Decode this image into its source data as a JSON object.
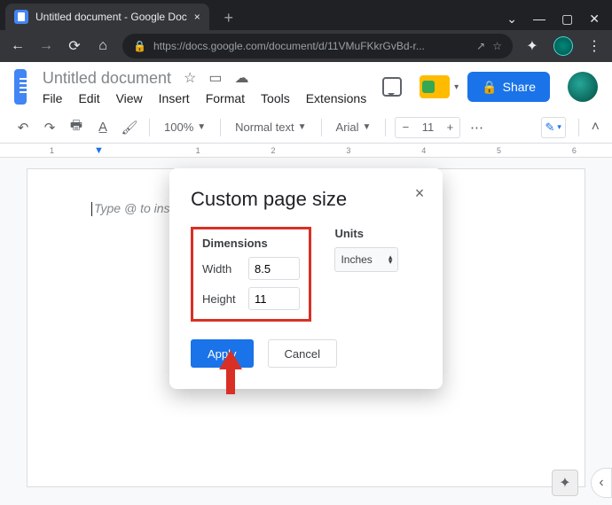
{
  "browser": {
    "tab_title": "Untitled document - Google Doc",
    "url": "https://docs.google.com/document/d/11VMuFKkrGvBd-r..."
  },
  "doc": {
    "title": "Untitled document",
    "menus": [
      "File",
      "Edit",
      "View",
      "Insert",
      "Format",
      "Tools",
      "Extensions"
    ],
    "share_label": "Share"
  },
  "toolbar": {
    "zoom": "100%",
    "style": "Normal text",
    "font": "Arial",
    "font_size": "11"
  },
  "ruler": {
    "labels": [
      "1",
      "",
      "1",
      "2",
      "3",
      "4",
      "5",
      "6"
    ]
  },
  "editor": {
    "placeholder": "Type @ to ins"
  },
  "modal": {
    "title": "Custom page size",
    "dimensions_label": "Dimensions",
    "width_label": "Width",
    "width_value": "8.5",
    "height_label": "Height",
    "height_value": "11",
    "units_label": "Units",
    "units_value": "Inches",
    "apply": "Apply",
    "cancel": "Cancel"
  }
}
